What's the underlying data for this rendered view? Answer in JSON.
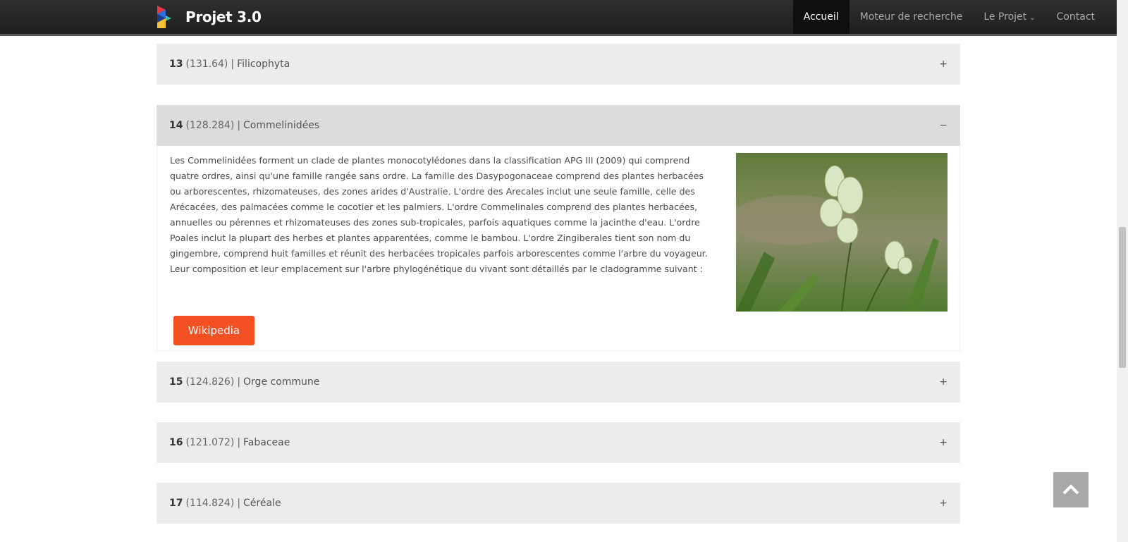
{
  "brand": {
    "name": "Projet 3.0"
  },
  "nav": {
    "items": [
      {
        "label": "Accueil",
        "active": true
      },
      {
        "label": "Moteur de recherche"
      },
      {
        "label": "Le Projet"
      },
      {
        "label": "Contact"
      }
    ]
  },
  "results": [
    {
      "rank": "13",
      "score": "(131.64)",
      "sep": "|",
      "name": "Filicophyta",
      "toggle": "+"
    },
    {
      "rank": "14",
      "score": "(128.284)",
      "sep": "|",
      "name": "Commelinidées",
      "toggle": "−",
      "description": "Les Commelinidées forment un clade de plantes monocotylédones dans la classification APG III (2009) qui comprend quatre ordres, ainsi qu'une famille rangée sans ordre. La famille des Dasypogonaceae comprend des plantes herbacées ou arborescentes, rhizomateuses, des zones arides d'Australie. L'ordre des Arecales inclut une seule famille, celle des Arécacées, des palmacées comme le cocotier et les palmiers. L'ordre Commelinales comprend des plantes herbacées, annuelles ou pérennes et rhizomateuses des zones sub-tropicales, parfois aquatiques comme la jacinthe d'eau. L'ordre Poales inclut la plupart des herbes et plantes apparentées, comme le bambou. L'ordre Zingiberales tient son nom du gingembre, comprend huit familles et réunit des herbacées tropicales parfois arborescentes comme l'arbre du voyageur. Leur composition et leur emplacement sur l'arbre phylogénétique du vivant sont détaillés par le cladogramme suivant :",
      "button": "Wikipedia"
    },
    {
      "rank": "15",
      "score": "(124.826)",
      "sep": "|",
      "name": "Orge commune",
      "toggle": "+"
    },
    {
      "rank": "16",
      "score": "(121.072)",
      "sep": "|",
      "name": "Fabaceae",
      "toggle": "+"
    },
    {
      "rank": "17",
      "score": "(114.824)",
      "sep": "|",
      "name": "Céréale",
      "toggle": "+"
    }
  ],
  "colors": {
    "button": "#f25022",
    "navbar": "#252525",
    "panel": "#ececec",
    "panel_open": "#dcdcdc"
  },
  "icons": {
    "scroll_top": "chevron-up-icon",
    "logo": "logo-icon"
  }
}
